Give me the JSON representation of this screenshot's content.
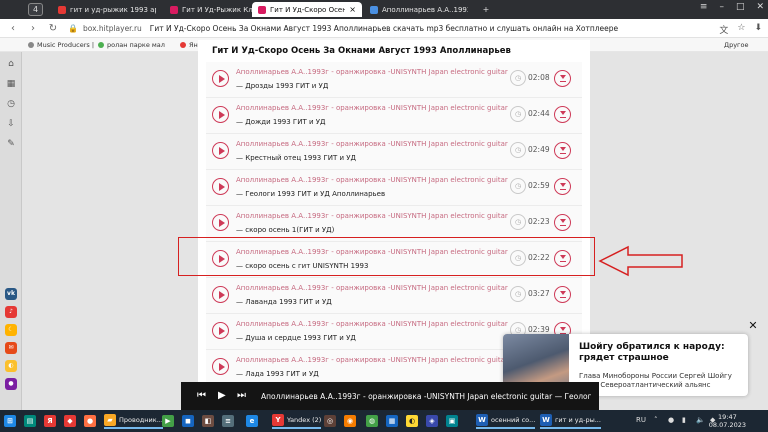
{
  "browser": {
    "tab_count": "4",
    "tabs": [
      {
        "label": "гит и уд-рыжик 1993 appo",
        "fav_color": "#e53935"
      },
      {
        "label": "Гит И Уд-Рыжик Классно",
        "fav_color": "#d81b60"
      },
      {
        "label": "Гит И Уд-Скоро Осень",
        "fav_color": "#d81b60"
      },
      {
        "label": "Аполлинарьев А.А..1993г",
        "fav_color": "#4a90e2"
      }
    ],
    "tab_close": "×",
    "new_tab": "+",
    "domain": "box.hitplayer.ru",
    "page_title": "Гит И Уд-Скоро Осень За Окнами Август 1993 Аполлинарьев скачать mp3 бесплатно и слушать онлайн на Хотплеере",
    "bookmarks": [
      "Music Producers |",
      "ролан парке мал",
      "Яндекс"
    ],
    "other_bookmarks": "Другое"
  },
  "playlist": {
    "title": "Гит И Уд-Скоро Осень За Окнами Август 1993 Аполлинарьев",
    "tracks": [
      {
        "artist": "Аполлинарьев А.А..1993г - оранжировка -UNISYNTH Japan electronic guitar",
        "song": "— Дрозды 1993 ГИТ и УД",
        "duration": "02:08"
      },
      {
        "artist": "Аполлинарьев А.А..1993г - оранжировка -UNISYNTH Japan electronic guitar",
        "song": "— Дожди 1993 ГИТ и УД",
        "duration": "02:44"
      },
      {
        "artist": "Аполлинарьев А.А..1993г - оранжировка -UNISYNTH Japan electronic guitar",
        "song": "— Крестный отец 1993 ГИТ и УД",
        "duration": "02:49"
      },
      {
        "artist": "Аполлинарьев А.А..1993г - оранжировка -UNISYNTH Japan electronic guitar",
        "song": "— Геологи 1993 ГИТ и УД Аполлинарьев",
        "duration": "02:59"
      },
      {
        "artist": "Аполлинарьев А.А..1993г - оранжировка -UNISYNTH Japan electronic guitar",
        "song": "— скоро осень 1(ГИТ и УД)",
        "duration": "02:23"
      },
      {
        "artist": "Аполлинарьев А.А..1993г - оранжировка -UNISYNTH Japan electronic guitar",
        "song": "— скоро осень с гит UNISYNTH 1993",
        "duration": "02:22"
      },
      {
        "artist": "Аполлинарьев А.А..1993г - оранжировка -UNISYNTH Japan electronic guitar",
        "song": "— Лаванда 1993 ГИТ и УД",
        "duration": "03:27"
      },
      {
        "artist": "Аполлинарьев А.А..1993г - оранжировка -UNISYNTH Japan electronic guitar",
        "song": "— Душа и сердце 1993 ГИТ и УД",
        "duration": "02:39"
      },
      {
        "artist": "Аполлинарьев А.А..1993г - оранжировка -UNISYNTH Japan electronic guitar",
        "song": "— Лада 1993 ГИТ и УД",
        "duration": ""
      }
    ]
  },
  "player": {
    "now_playing": "Аполлинарьев А.А..1993г - оранжировка -UNISYNTH Japan electronic guitar — Геологи 19"
  },
  "notification": {
    "headline": "Шойгу обратился к народу: грядет страшное",
    "body": "Глава Минобороны России Сергей Шойгу ...что Североатлантический альянс"
  },
  "taskbar": {
    "items": [
      "Проводник...",
      "Yandex (2)",
      "осенний со...",
      "гит и уд-ры..."
    ],
    "lang": "RU",
    "time": "19:47",
    "date": "08.07.2023"
  }
}
